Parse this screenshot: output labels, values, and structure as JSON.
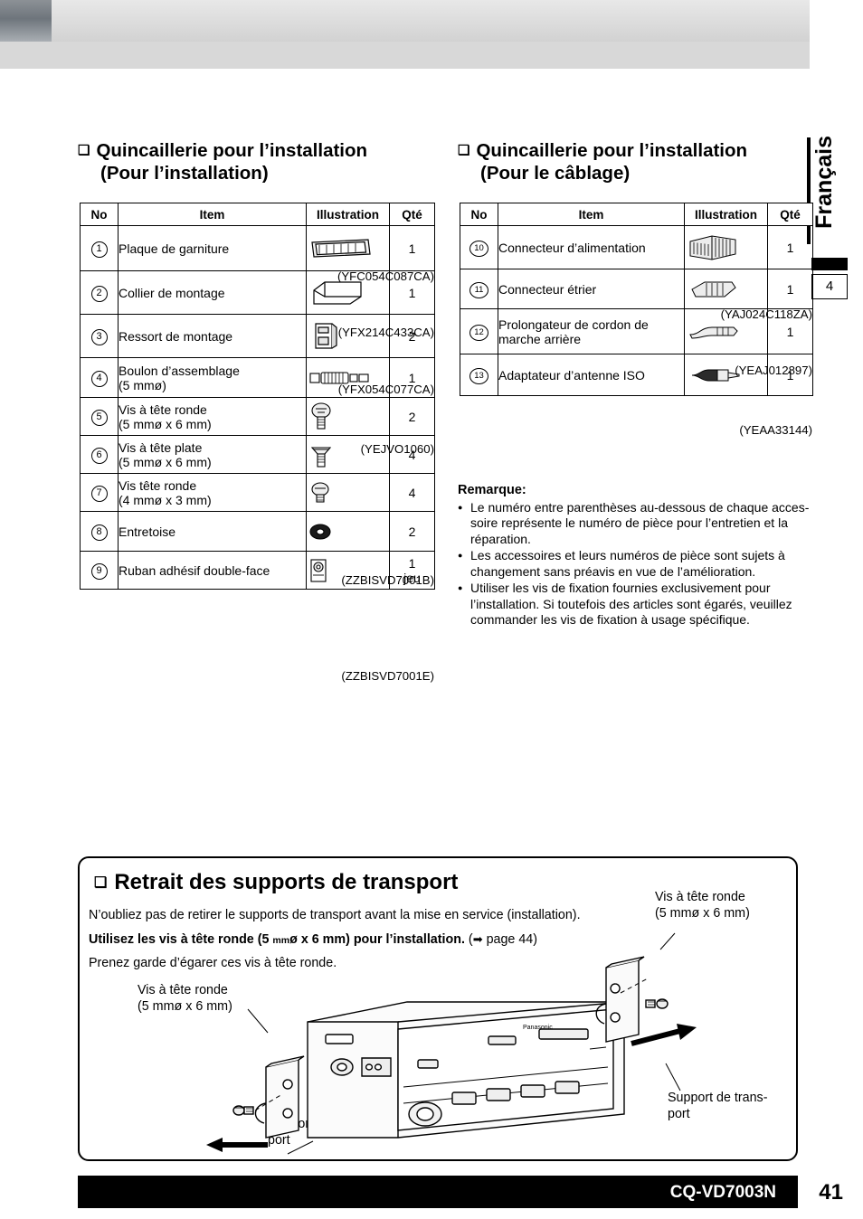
{
  "page": {
    "language_tab": "Français",
    "chapter_number": "4",
    "model": "CQ-VD7003N",
    "page_number": "41"
  },
  "section_install": {
    "heading_line1": "Quincaillerie pour l’installation",
    "heading_line2": "(Pour l’installation)",
    "columns": [
      "No",
      "Item",
      "Illustration",
      "Qté"
    ],
    "rows": [
      {
        "no": "1",
        "item": "Plaque de garniture",
        "qty": "1",
        "icon": "trim-plate-icon"
      },
      {
        "no": "2",
        "item": "Collier de montage",
        "qty": "1",
        "icon": "mounting-collar-icon"
      },
      {
        "no": "3",
        "item": "Ressort de montage",
        "qty": "2",
        "icon": "mounting-spring-icon"
      },
      {
        "no": "4",
        "item": "Boulon d’assemblage",
        "item2": "(5 mmø)",
        "qty": "1",
        "icon": "assembly-bolt-icon"
      },
      {
        "no": "5",
        "item": "Vis à tête ronde",
        "item2": "(5 mmø x 6 mm)",
        "qty": "2",
        "icon": "round-head-screw-icon"
      },
      {
        "no": "6",
        "item": "Vis à tête plate",
        "item2": "(5 mmø x 6 mm)",
        "qty": "4",
        "icon": "flat-head-screw-icon"
      },
      {
        "no": "7",
        "item": "Vis tête ronde",
        "item2": "(4 mmø x 3 mm)",
        "qty": "4",
        "icon": "round-head-screw-small-icon"
      },
      {
        "no": "8",
        "item": "Entretoise",
        "qty": "2",
        "icon": "spacer-icon"
      },
      {
        "no": "9",
        "item": "Ruban adhésif double-face",
        "qty": "1",
        "qty2": "jeu",
        "icon": "double-sided-tape-icon"
      }
    ],
    "part_numbers": [
      "(YFC054C087CA)",
      "(YFX214C433CA)",
      "(YFX054C077CA)",
      "(YEJVO1060)",
      "(ZZBISVD7001B)",
      "(ZZBISVD7001E)"
    ]
  },
  "section_wiring": {
    "heading_line1": "Quincaillerie pour l’installation",
    "heading_line2": "(Pour le câblage)",
    "columns": [
      "No",
      "Item",
      "Illustration",
      "Qté"
    ],
    "rows": [
      {
        "no": "10",
        "item": "Connecteur d’alimentation",
        "qty": "1",
        "icon": "power-connector-icon"
      },
      {
        "no": "11",
        "item": "Connecteur étrier",
        "qty": "1",
        "icon": "stirrup-connector-icon"
      },
      {
        "no": "12",
        "item": "Prolongateur de cordon de",
        "item2": "marche arrière",
        "qty": "1",
        "icon": "reverse-cord-extension-icon"
      },
      {
        "no": "13",
        "item": "Adaptateur d’antenne ISO",
        "qty": "1",
        "icon": "iso-antenna-adapter-icon"
      }
    ],
    "part_numbers": [
      "(YAJ024C118ZA)",
      "(YEAJ012897)",
      "(YEAA33144)"
    ]
  },
  "remark": {
    "title": "Remarque:",
    "items": [
      "Le numéro entre parenthèses au-dessous de chaque acces-soire représente le numéro de pièce pour l’entretien et la réparation.",
      "Les accessoires et leurs numéros de pièce sont sujets à changement sans préavis en vue de l’amélioration.",
      "Utiliser les vis de fixation fournies exclusivement pour l’installation. Si toutefois des articles sont égarés, veuillez commander les vis de fixation à usage spécifique."
    ]
  },
  "transport": {
    "title": "Retrait des supports de transport",
    "line1": "N’oubliez pas de retirer le supports de transport avant la mise en service (installation).",
    "line2_bold_a": "Utilisez les vis à tête ronde (5 ",
    "line2_bold_mm": "mm",
    "line2_bold_b": "ø x 6 mm) pour l’installation.",
    "line2_ref": "page 44",
    "line2_paren_open": "(",
    "line2_paren_close": ")",
    "line3": "Prenez garde d’égarer ces vis à tête ronde.",
    "label_screw_left_1": "Vis à tête ronde",
    "label_screw_left_2": "(5 mmø x 6 mm)",
    "label_screw_right_1": "Vis à tête ronde",
    "label_screw_right_2": "(5 mmø x 6 mm)",
    "label_bracket_left_1": "Support de trans-",
    "label_bracket_left_2": "port",
    "label_bracket_right_1": "Support de trans-",
    "label_bracket_right_2": "port",
    "unit_brand": "Panasonic"
  }
}
